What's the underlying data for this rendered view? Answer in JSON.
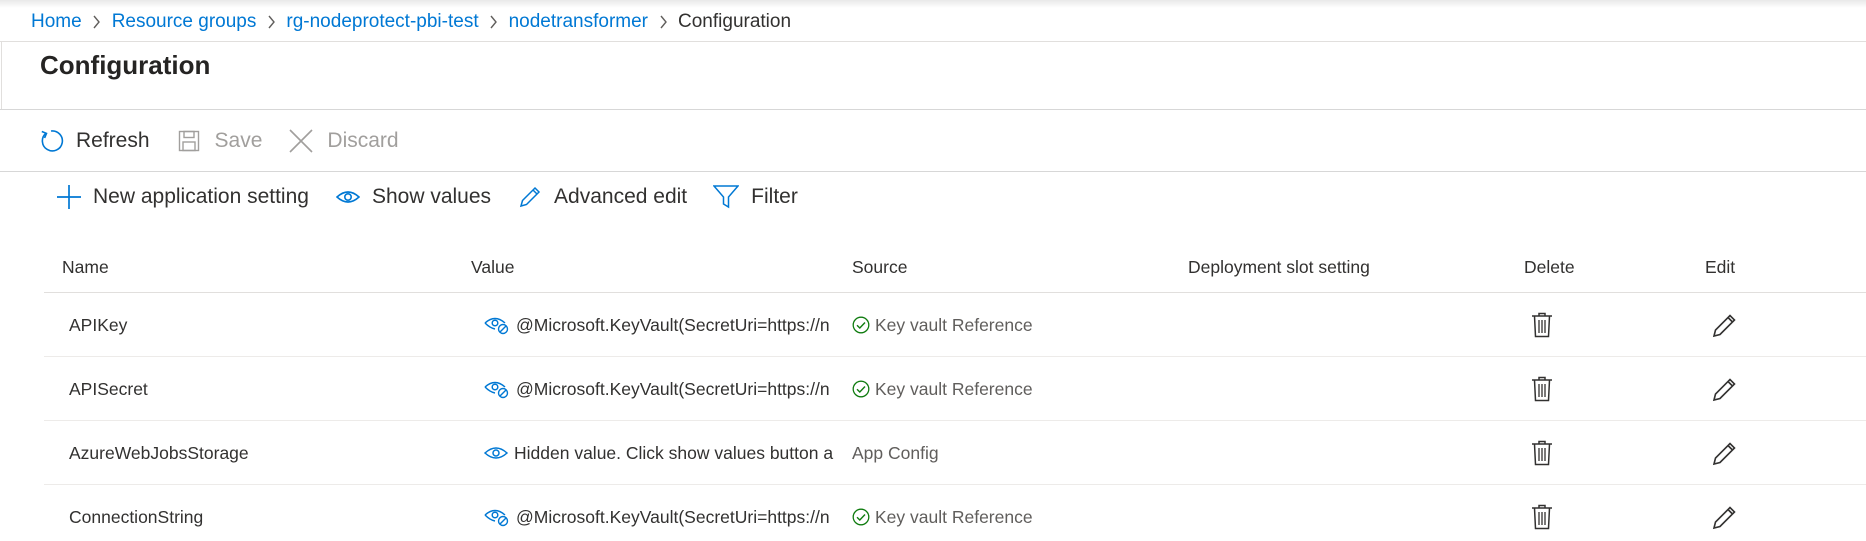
{
  "breadcrumb": [
    "Home",
    "Resource groups",
    "rg-nodeprotect-pbi-test",
    "nodetransformer",
    "Configuration"
  ],
  "page": {
    "title": "Configuration"
  },
  "toolbar": {
    "refresh": "Refresh",
    "save": "Save",
    "discard": "Discard"
  },
  "subtoolbar": {
    "new_setting": "New application setting",
    "show_values": "Show values",
    "advanced_edit": "Advanced edit",
    "filter": "Filter"
  },
  "table": {
    "headers": {
      "name": "Name",
      "value": "Value",
      "source": "Source",
      "slot": "Deployment slot setting",
      "delete": "Delete",
      "edit": "Edit"
    },
    "rows": [
      {
        "name": "APIKey",
        "value": "@Microsoft.KeyVault(SecretUri=https://n",
        "value_icon": "eye-hidden-icon",
        "source": "Key vault Reference",
        "source_icon": "check-circle-icon"
      },
      {
        "name": "APISecret",
        "value": "@Microsoft.KeyVault(SecretUri=https://n",
        "value_icon": "eye-hidden-icon",
        "source": "Key vault Reference",
        "source_icon": "check-circle-icon"
      },
      {
        "name": "AzureWebJobsStorage",
        "value": "Hidden value. Click show values button a",
        "value_icon": "eye-icon",
        "source": "App Config",
        "source_icon": ""
      },
      {
        "name": "ConnectionString",
        "value": "@Microsoft.KeyVault(SecretUri=https://n",
        "value_icon": "eye-hidden-icon",
        "source": "Key vault Reference",
        "source_icon": "check-circle-icon"
      }
    ]
  },
  "colors": {
    "accent": "#0078d4",
    "success": "#107c10",
    "text": "#323130",
    "disabled": "#a19f9d"
  }
}
